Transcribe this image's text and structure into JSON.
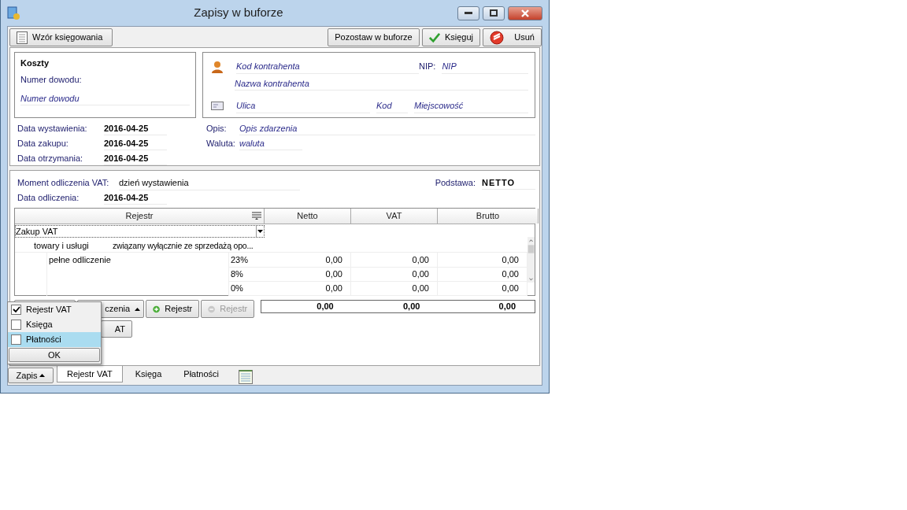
{
  "window": {
    "title": "Zapisy w buforze"
  },
  "toolbar": {
    "left": [
      {
        "label": "Wzór księgowania",
        "kind": "template"
      }
    ],
    "right": [
      {
        "label": "Pozostaw w buforze",
        "kind": "plain"
      },
      {
        "label": "Księguj",
        "kind": "post"
      },
      {
        "label": "Usuń",
        "kind": "delete"
      }
    ]
  },
  "document": {
    "type": "Koszty",
    "number_label": "Numer dowodu:",
    "number_placeholder": "Numer dowodu"
  },
  "contractor": {
    "code_placeholder": "Kod kontrahenta",
    "nip_label": "NIP:",
    "nip_placeholder": "NIP",
    "name_placeholder": "Nazwa kontrahenta",
    "street_placeholder": "Ulica",
    "postal_placeholder": "Kod",
    "city_placeholder": "Miejscowość"
  },
  "dates": [
    {
      "label": "Data wystawienia:",
      "value": "2016-04-25"
    },
    {
      "label": "Data zakupu:",
      "value": "2016-04-25"
    },
    {
      "label": "Data otrzymania:",
      "value": "2016-04-25"
    }
  ],
  "description": {
    "label": "Opis:",
    "placeholder": "Opis zdarzenia"
  },
  "currency": {
    "label": "Waluta:",
    "placeholder": "waluta"
  },
  "vat": {
    "moment_label": "Moment odliczenia VAT:",
    "moment_value": "dzień wystawienia",
    "basis_label": "Podstawa:",
    "basis_value": "NETTO",
    "date_label": "Data odliczenia:",
    "date_value": "2016-04-25"
  },
  "grid": {
    "columns": [
      "Rejestr",
      "Netto",
      "VAT",
      "Brutto"
    ],
    "register": "Zakup VAT",
    "group": {
      "type": "towary i usługi",
      "relation": "związany wyłącznie ze sprzedażą opo..."
    },
    "deduction": "pełne odliczenie",
    "rows": [
      {
        "rate": "23%",
        "netto": "0,00",
        "vat": "0,00",
        "brutto": "0,00"
      },
      {
        "rate": "8%",
        "netto": "0,00",
        "vat": "0,00",
        "brutto": "0,00"
      },
      {
        "rate": "0%",
        "netto": "0,00",
        "vat": "0,00",
        "brutto": "0,00"
      }
    ],
    "totals": [
      "0,00",
      "0,00",
      "0,00"
    ]
  },
  "grid_buttons": [
    {
      "label": "czenia",
      "kind": "dropdown",
      "disabled": false
    },
    {
      "label": "Rejestr",
      "kind": "add",
      "disabled": false
    },
    {
      "label": "Rejestr",
      "kind": "remove",
      "disabled": true
    }
  ],
  "extra_button": {
    "label": "AT"
  },
  "popup": {
    "items": [
      {
        "label": "Rejestr VAT",
        "checked": true,
        "selected": false
      },
      {
        "label": "Księga",
        "checked": false,
        "selected": false
      },
      {
        "label": "Płatności",
        "checked": false,
        "selected": true
      }
    ],
    "ok": "OK"
  },
  "bottom": {
    "zapis": "Zapis",
    "tabs": [
      {
        "label": "Rejestr VAT",
        "selected": true
      },
      {
        "label": "Księga",
        "selected": false
      },
      {
        "label": "Płatności",
        "selected": false
      }
    ]
  }
}
